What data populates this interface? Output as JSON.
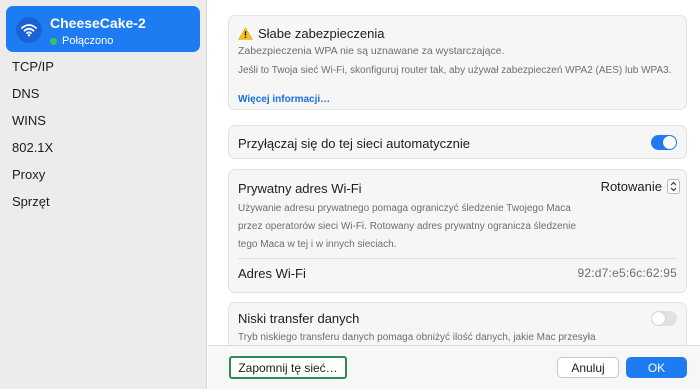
{
  "sidebar": {
    "network": {
      "name": "CheeseCake-2",
      "status": "Połączono",
      "icon": "wifi-icon"
    },
    "items": [
      {
        "label": "TCP/IP"
      },
      {
        "label": "DNS"
      },
      {
        "label": "WINS"
      },
      {
        "label": "802.1X"
      },
      {
        "label": "Proxy"
      },
      {
        "label": "Sprzęt"
      }
    ]
  },
  "warning": {
    "icon": "warning-triangle-icon",
    "title": "Słabe zabezpieczenia",
    "subtitle": "Zabezpieczenia WPA nie są uznawane za wystarczające.",
    "description": "Jeśli to Twoja sieć Wi-Fi, skonfiguruj router tak, aby używał zabezpieczeń WPA2 (AES) lub WPA3.",
    "link": "Więcej informacji…"
  },
  "auto_join": {
    "label": "Przyłączaj się do tej sieci automatycznie",
    "enabled": true
  },
  "private_address": {
    "title": "Prywatny adres Wi-Fi",
    "mode": "Rotowanie",
    "description": "Używanie adresu prywatnego pomaga ograniczyć śledzenie Twojego Maca przez operatorów sieci Wi-Fi. Rotowany adres prywatny ogranicza śledzenie tego Maca w tej i w innych sieciach.",
    "address_label": "Adres Wi-Fi",
    "address_value": "92:d7:e5:6c:62:95"
  },
  "low_data": {
    "title": "Niski transfer danych",
    "description": "Tryb niskiego transferu danych pomaga obniżyć ilość danych, jakie Mac przesyła",
    "enabled": false
  },
  "footer": {
    "forget_label": "Zapomnij tę sieć…",
    "cancel_label": "Anuluj",
    "ok_label": "OK"
  },
  "colors": {
    "accent": "#1e7cf2",
    "connected": "#35c659",
    "focus_ring": "#2e8b57",
    "warning": "#f5c518"
  }
}
